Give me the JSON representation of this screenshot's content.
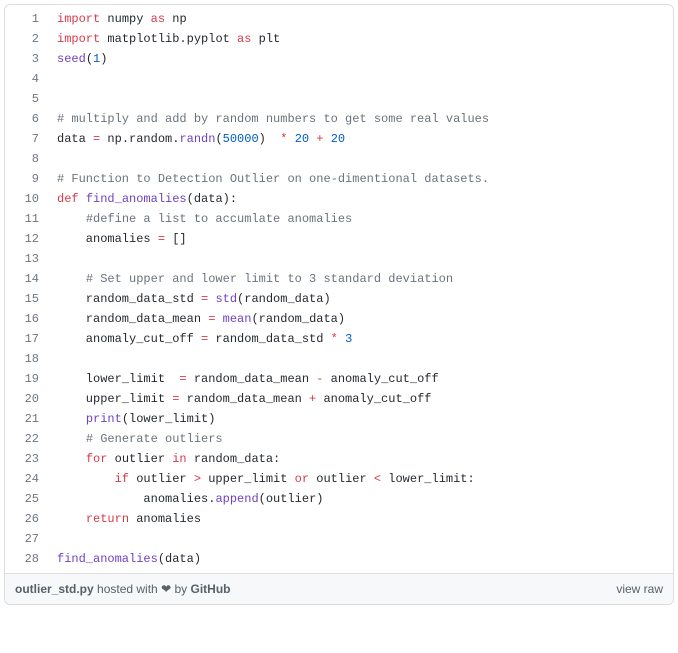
{
  "code": {
    "lines": [
      {
        "num": "1",
        "tokens": [
          {
            "c": "kw",
            "t": "import"
          },
          {
            "c": "nm",
            "t": " numpy "
          },
          {
            "c": "kw",
            "t": "as"
          },
          {
            "c": "nm",
            "t": " np"
          }
        ]
      },
      {
        "num": "2",
        "tokens": [
          {
            "c": "kw",
            "t": "import"
          },
          {
            "c": "nm",
            "t": " matplotlib.pyplot "
          },
          {
            "c": "kw",
            "t": "as"
          },
          {
            "c": "nm",
            "t": " plt"
          }
        ]
      },
      {
        "num": "3",
        "tokens": [
          {
            "c": "fn",
            "t": "seed"
          },
          {
            "c": "par",
            "t": "("
          },
          {
            "c": "num",
            "t": "1"
          },
          {
            "c": "par",
            "t": ")"
          }
        ]
      },
      {
        "num": "4",
        "tokens": [
          {
            "c": "nm",
            "t": ""
          }
        ]
      },
      {
        "num": "5",
        "tokens": [
          {
            "c": "nm",
            "t": ""
          }
        ]
      },
      {
        "num": "6",
        "tokens": [
          {
            "c": "cmt",
            "t": "# multiply and add by random numbers to get some real values"
          }
        ]
      },
      {
        "num": "7",
        "tokens": [
          {
            "c": "nm",
            "t": "data "
          },
          {
            "c": "op",
            "t": "="
          },
          {
            "c": "nm",
            "t": " np.random."
          },
          {
            "c": "fn",
            "t": "randn"
          },
          {
            "c": "par",
            "t": "("
          },
          {
            "c": "num",
            "t": "50000"
          },
          {
            "c": "par",
            "t": ")"
          },
          {
            "c": "nm",
            "t": "  "
          },
          {
            "c": "op",
            "t": "*"
          },
          {
            "c": "nm",
            "t": " "
          },
          {
            "c": "num",
            "t": "20"
          },
          {
            "c": "nm",
            "t": " "
          },
          {
            "c": "op",
            "t": "+"
          },
          {
            "c": "nm",
            "t": " "
          },
          {
            "c": "num",
            "t": "20"
          }
        ]
      },
      {
        "num": "8",
        "tokens": [
          {
            "c": "nm",
            "t": ""
          }
        ]
      },
      {
        "num": "9",
        "tokens": [
          {
            "c": "cmt",
            "t": "# Function to Detection Outlier on one-dimentional datasets."
          }
        ]
      },
      {
        "num": "10",
        "tokens": [
          {
            "c": "kw",
            "t": "def"
          },
          {
            "c": "nm",
            "t": " "
          },
          {
            "c": "fn",
            "t": "find_anomalies"
          },
          {
            "c": "par",
            "t": "("
          },
          {
            "c": "nm",
            "t": "data"
          },
          {
            "c": "par",
            "t": ")"
          },
          {
            "c": "nm",
            "t": ":"
          }
        ]
      },
      {
        "num": "11",
        "tokens": [
          {
            "c": "nm",
            "t": "    "
          },
          {
            "c": "cmt",
            "t": "#define a list to accumlate anomalies"
          }
        ]
      },
      {
        "num": "12",
        "tokens": [
          {
            "c": "nm",
            "t": "    anomalies "
          },
          {
            "c": "op",
            "t": "="
          },
          {
            "c": "nm",
            "t": " []"
          }
        ]
      },
      {
        "num": "13",
        "tokens": [
          {
            "c": "nm",
            "t": ""
          }
        ]
      },
      {
        "num": "14",
        "tokens": [
          {
            "c": "nm",
            "t": "    "
          },
          {
            "c": "cmt",
            "t": "# Set upper and lower limit to 3 standard deviation"
          }
        ]
      },
      {
        "num": "15",
        "tokens": [
          {
            "c": "nm",
            "t": "    random_data_std "
          },
          {
            "c": "op",
            "t": "="
          },
          {
            "c": "nm",
            "t": " "
          },
          {
            "c": "fn",
            "t": "std"
          },
          {
            "c": "par",
            "t": "("
          },
          {
            "c": "nm",
            "t": "random_data"
          },
          {
            "c": "par",
            "t": ")"
          }
        ]
      },
      {
        "num": "16",
        "tokens": [
          {
            "c": "nm",
            "t": "    random_data_mean "
          },
          {
            "c": "op",
            "t": "="
          },
          {
            "c": "nm",
            "t": " "
          },
          {
            "c": "fn",
            "t": "mean"
          },
          {
            "c": "par",
            "t": "("
          },
          {
            "c": "nm",
            "t": "random_data"
          },
          {
            "c": "par",
            "t": ")"
          }
        ]
      },
      {
        "num": "17",
        "tokens": [
          {
            "c": "nm",
            "t": "    anomaly_cut_off "
          },
          {
            "c": "op",
            "t": "="
          },
          {
            "c": "nm",
            "t": " random_data_std "
          },
          {
            "c": "op",
            "t": "*"
          },
          {
            "c": "nm",
            "t": " "
          },
          {
            "c": "num",
            "t": "3"
          }
        ]
      },
      {
        "num": "18",
        "tokens": [
          {
            "c": "nm",
            "t": ""
          }
        ]
      },
      {
        "num": "19",
        "tokens": [
          {
            "c": "nm",
            "t": "    lower_limit  "
          },
          {
            "c": "op",
            "t": "="
          },
          {
            "c": "nm",
            "t": " random_data_mean "
          },
          {
            "c": "op",
            "t": "-"
          },
          {
            "c": "nm",
            "t": " anomaly_cut_off "
          }
        ]
      },
      {
        "num": "20",
        "tokens": [
          {
            "c": "nm",
            "t": "    upper_limit "
          },
          {
            "c": "op",
            "t": "="
          },
          {
            "c": "nm",
            "t": " random_data_mean "
          },
          {
            "c": "op",
            "t": "+"
          },
          {
            "c": "nm",
            "t": " anomaly_cut_off"
          }
        ]
      },
      {
        "num": "21",
        "tokens": [
          {
            "c": "nm",
            "t": "    "
          },
          {
            "c": "fn",
            "t": "print"
          },
          {
            "c": "par",
            "t": "("
          },
          {
            "c": "nm",
            "t": "lower_limit"
          },
          {
            "c": "par",
            "t": ")"
          }
        ]
      },
      {
        "num": "22",
        "tokens": [
          {
            "c": "nm",
            "t": "    "
          },
          {
            "c": "cmt",
            "t": "# Generate outliers"
          }
        ]
      },
      {
        "num": "23",
        "tokens": [
          {
            "c": "nm",
            "t": "    "
          },
          {
            "c": "kw",
            "t": "for"
          },
          {
            "c": "nm",
            "t": " outlier "
          },
          {
            "c": "kw",
            "t": "in"
          },
          {
            "c": "nm",
            "t": " random_data:"
          }
        ]
      },
      {
        "num": "24",
        "tokens": [
          {
            "c": "nm",
            "t": "        "
          },
          {
            "c": "kw",
            "t": "if"
          },
          {
            "c": "nm",
            "t": " outlier "
          },
          {
            "c": "op",
            "t": ">"
          },
          {
            "c": "nm",
            "t": " upper_limit "
          },
          {
            "c": "kw",
            "t": "or"
          },
          {
            "c": "nm",
            "t": " outlier "
          },
          {
            "c": "op",
            "t": "<"
          },
          {
            "c": "nm",
            "t": " lower_limit:"
          }
        ]
      },
      {
        "num": "25",
        "tokens": [
          {
            "c": "nm",
            "t": "            anomalies."
          },
          {
            "c": "fn",
            "t": "append"
          },
          {
            "c": "par",
            "t": "("
          },
          {
            "c": "nm",
            "t": "outlier"
          },
          {
            "c": "par",
            "t": ")"
          }
        ]
      },
      {
        "num": "26",
        "tokens": [
          {
            "c": "nm",
            "t": "    "
          },
          {
            "c": "kw",
            "t": "return"
          },
          {
            "c": "nm",
            "t": " anomalies"
          }
        ]
      },
      {
        "num": "27",
        "tokens": [
          {
            "c": "nm",
            "t": ""
          }
        ]
      },
      {
        "num": "28",
        "tokens": [
          {
            "c": "fn",
            "t": "find_anomalies"
          },
          {
            "c": "par",
            "t": "("
          },
          {
            "c": "nm",
            "t": "data"
          },
          {
            "c": "par",
            "t": ")"
          }
        ]
      }
    ]
  },
  "meta": {
    "filename": "outlier_std.py",
    "hosted_text": " hosted with ",
    "heart": "❤",
    "by_text": " by ",
    "host": "GitHub",
    "view_raw": "view raw"
  }
}
